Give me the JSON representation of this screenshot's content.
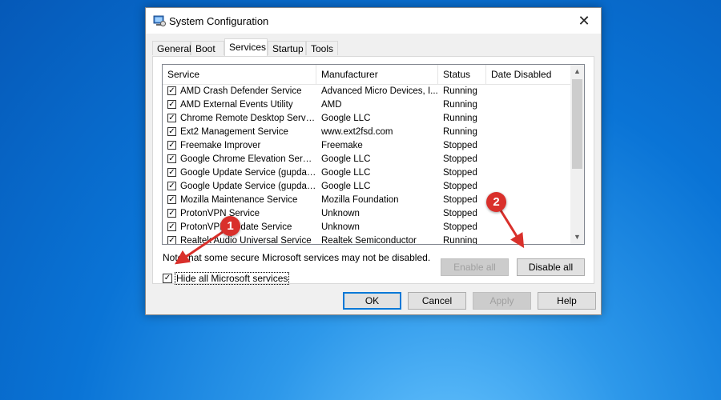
{
  "dialog": {
    "title": "System Configuration",
    "close_glyph": "✕",
    "icon": "system-config-icon"
  },
  "tabs": [
    {
      "label": "General",
      "active": false
    },
    {
      "label": "Boot",
      "active": false
    },
    {
      "label": "Services",
      "active": true
    },
    {
      "label": "Startup",
      "active": false
    },
    {
      "label": "Tools",
      "active": false
    }
  ],
  "list": {
    "headers": {
      "service": "Service",
      "manufacturer": "Manufacturer",
      "status": "Status",
      "date_disabled": "Date Disabled"
    },
    "rows": [
      {
        "checked": true,
        "service": "AMD Crash Defender Service",
        "manufacturer": "Advanced Micro Devices, I...",
        "status": "Running",
        "date": ""
      },
      {
        "checked": true,
        "service": "AMD External Events Utility",
        "manufacturer": "AMD",
        "status": "Running",
        "date": ""
      },
      {
        "checked": true,
        "service": "Chrome Remote Desktop Service",
        "manufacturer": "Google LLC",
        "status": "Running",
        "date": ""
      },
      {
        "checked": true,
        "service": "Ext2 Management Service",
        "manufacturer": "www.ext2fsd.com",
        "status": "Running",
        "date": ""
      },
      {
        "checked": true,
        "service": "Freemake Improver",
        "manufacturer": "Freemake",
        "status": "Stopped",
        "date": ""
      },
      {
        "checked": true,
        "service": "Google Chrome Elevation Servic...",
        "manufacturer": "Google LLC",
        "status": "Stopped",
        "date": ""
      },
      {
        "checked": true,
        "service": "Google Update Service (gupdate)",
        "manufacturer": "Google LLC",
        "status": "Stopped",
        "date": ""
      },
      {
        "checked": true,
        "service": "Google Update Service (gupdatem)",
        "manufacturer": "Google LLC",
        "status": "Stopped",
        "date": ""
      },
      {
        "checked": true,
        "service": "Mozilla Maintenance Service",
        "manufacturer": "Mozilla Foundation",
        "status": "Stopped",
        "date": ""
      },
      {
        "checked": true,
        "service": "ProtonVPN Service",
        "manufacturer": "Unknown",
        "status": "Stopped",
        "date": ""
      },
      {
        "checked": true,
        "service": "ProtonVPN Update Service",
        "manufacturer": "Unknown",
        "status": "Stopped",
        "date": ""
      },
      {
        "checked": true,
        "service": "Realtek Audio Universal Service",
        "manufacturer": "Realtek Semiconductor",
        "status": "Running",
        "date": ""
      }
    ]
  },
  "note": "Note that some secure Microsoft services may not be disabled.",
  "hide_ms_label": "Hide all Microsoft services",
  "hide_ms_checked": true,
  "buttons": {
    "enable_all": "Enable all",
    "disable_all": "Disable all",
    "ok": "OK",
    "cancel": "Cancel",
    "apply": "Apply",
    "help": "Help"
  },
  "annotations": {
    "badge1": "1",
    "badge2": "2",
    "color": "#d9302b"
  }
}
